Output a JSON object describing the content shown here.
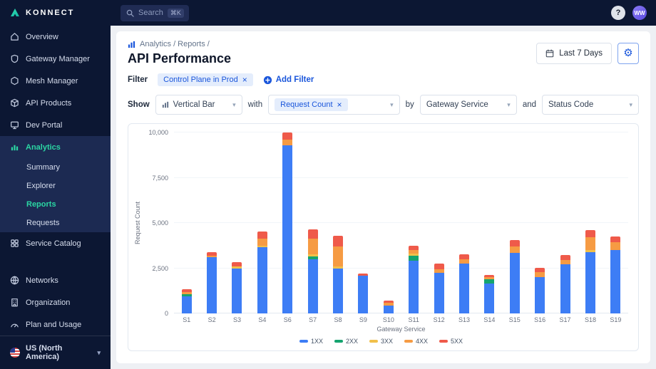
{
  "topbar": {
    "logo_text": "KONNECT",
    "search": {
      "label": "Search",
      "shortcut": "⌘K"
    },
    "help_label": "?",
    "avatar_initials": "WW"
  },
  "icons": {
    "close": "×",
    "chevron_down": "▾",
    "gear": "⚙"
  },
  "sidebar": {
    "items": [
      {
        "label": "Overview"
      },
      {
        "label": "Gateway Manager"
      },
      {
        "label": "Mesh Manager"
      },
      {
        "label": "API Products"
      },
      {
        "label": "Dev Portal"
      }
    ],
    "analytics": {
      "label": "Analytics",
      "subitems": [
        {
          "label": "Summary"
        },
        {
          "label": "Explorer"
        },
        {
          "label": "Reports",
          "active": true
        },
        {
          "label": "Requests"
        }
      ]
    },
    "service_catalog": "Service Catalog",
    "bottom_items": [
      {
        "label": "Networks"
      },
      {
        "label": "Organization"
      },
      {
        "label": "Plan and Usage"
      }
    ],
    "region": "US (North America)"
  },
  "header": {
    "breadcrumb": "Analytics / Reports /",
    "title": "API Performance",
    "date_range": "Last 7 Days"
  },
  "filter": {
    "label": "Filter",
    "chip": "Control Plane in Prod",
    "add_label": "Add Filter"
  },
  "controls": {
    "show_label": "Show",
    "chart_type": "Vertical Bar",
    "with_label": "with",
    "metric_chip": "Request Count",
    "by_label": "by",
    "group_by": "Gateway Service",
    "and_label": "and",
    "split_by": "Status Code"
  },
  "chart_data": {
    "type": "bar",
    "stacked": true,
    "title": "",
    "xlabel": "Gateway Service",
    "ylabel": "Request Count",
    "ylim": [
      0,
      10000
    ],
    "yticks": [
      0,
      2500,
      5000,
      7500,
      10000
    ],
    "grid": false,
    "legend_position": "bottom",
    "categories": [
      "S1",
      "S2",
      "S3",
      "S4",
      "S6",
      "S7",
      "S8",
      "S9",
      "S10",
      "S11",
      "S12",
      "S13",
      "S14",
      "S15",
      "S16",
      "S17",
      "S18",
      "S19"
    ],
    "series": [
      {
        "name": "1XX",
        "color": "#3d7df5",
        "values": [
          950,
          3100,
          2500,
          3650,
          9300,
          3000,
          2500,
          2100,
          450,
          2900,
          2250,
          2750,
          1650,
          3350,
          2000,
          2700,
          3400,
          3500
        ]
      },
      {
        "name": "2XX",
        "color": "#15a46f",
        "values": [
          100,
          0,
          0,
          0,
          0,
          150,
          0,
          0,
          0,
          300,
          0,
          0,
          250,
          0,
          0,
          0,
          0,
          0
        ]
      },
      {
        "name": "3XX",
        "color": "#f1c04a",
        "values": [
          0,
          0,
          100,
          100,
          0,
          100,
          100,
          0,
          0,
          100,
          0,
          0,
          0,
          0,
          0,
          0,
          120,
          0
        ]
      },
      {
        "name": "4XX",
        "color": "#f69b43",
        "values": [
          150,
          100,
          0,
          400,
          300,
          900,
          1100,
          0,
          150,
          200,
          200,
          250,
          120,
          350,
          280,
          250,
          700,
          450
        ]
      },
      {
        "name": "5XX",
        "color": "#ef5a4a",
        "values": [
          150,
          175,
          250,
          370,
          400,
          500,
          600,
          120,
          100,
          250,
          290,
          250,
          120,
          350,
          260,
          260,
          380,
          300
        ]
      }
    ]
  }
}
